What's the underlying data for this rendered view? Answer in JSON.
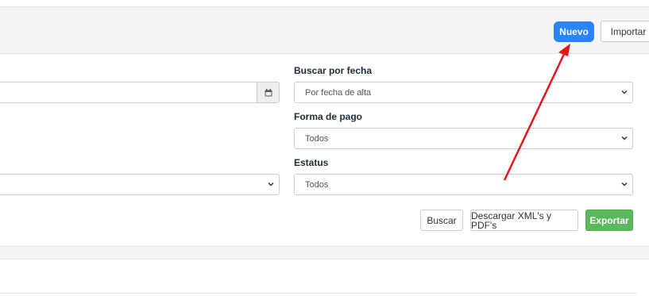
{
  "toolbar": {
    "new_label": "Nuevo",
    "import_label": "Importar"
  },
  "filters": {
    "date_search": {
      "label": "Buscar por fecha",
      "selected": "Por fecha de alta"
    },
    "payment_method": {
      "label": "Forma de pago",
      "selected": "Todos"
    },
    "status": {
      "label": "Estatus",
      "selected": "Todos"
    },
    "date_input": {
      "value": "",
      "icon": "calendar-icon"
    },
    "left_select": {
      "selected": ""
    }
  },
  "actions": {
    "search_label": "Buscar",
    "download_label": "Descargar XML's y PDF's",
    "export_label": "Exportar"
  },
  "colors": {
    "primary": "#2b84ff",
    "success": "#5cb85c",
    "annotation_arrow": "#e8141c"
  }
}
